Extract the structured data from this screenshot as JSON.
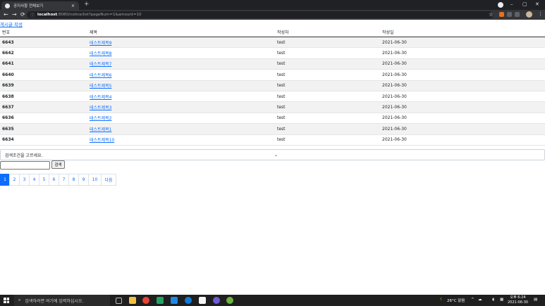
{
  "browser": {
    "tab_title": "공지사항 전체보기",
    "tab_close": "×",
    "new_tab": "+",
    "url_host": "localhost",
    "url_path": ":8080/notice/list?pageNum=1&amount=10",
    "window_min": "–",
    "window_max": "▢",
    "window_close": "✕"
  },
  "page": {
    "write_link": "게시글 작성",
    "table": {
      "headers": [
        "번호",
        "제목",
        "작성자",
        "작성일"
      ],
      "rows": [
        {
          "num": "6643",
          "title": "테스트제목9",
          "author": "test",
          "date": "2021-06-30"
        },
        {
          "num": "6642",
          "title": "테스트제목8",
          "author": "test",
          "date": "2021-06-30"
        },
        {
          "num": "6641",
          "title": "테스트제목7",
          "author": "test",
          "date": "2021-06-30"
        },
        {
          "num": "6640",
          "title": "테스트제목6",
          "author": "test",
          "date": "2021-06-30"
        },
        {
          "num": "6639",
          "title": "테스트제목5",
          "author": "test",
          "date": "2021-06-30"
        },
        {
          "num": "6638",
          "title": "테스트제목4",
          "author": "test",
          "date": "2021-06-30"
        },
        {
          "num": "6637",
          "title": "테스트제목3",
          "author": "test",
          "date": "2021-06-30"
        },
        {
          "num": "6636",
          "title": "테스트제목2",
          "author": "test",
          "date": "2021-06-30"
        },
        {
          "num": "6635",
          "title": "테스트제목1",
          "author": "test",
          "date": "2021-06-30"
        },
        {
          "num": "6634",
          "title": "테스트제목10",
          "author": "test",
          "date": "2021-06-30"
        }
      ]
    },
    "search": {
      "select_value": "검색조건을 고르세요.",
      "input_value": "",
      "button_label": "검색"
    },
    "pagination": {
      "pages": [
        "1",
        "2",
        "3",
        "4",
        "5",
        "6",
        "7",
        "8",
        "9",
        "10"
      ],
      "active": "1",
      "next_label": "다음"
    }
  },
  "taskbar": {
    "search_placeholder": "검색하려면 여기에 입력하십시오.",
    "weather": "26°C 맑음",
    "time": "오후 6:24",
    "date": "2021-06-30"
  },
  "colors": {
    "accent": "#0d6efd",
    "row_stripe": "#f2f2f2",
    "chrome_dark": "#202124",
    "taskbar": "#1f1f1f"
  }
}
